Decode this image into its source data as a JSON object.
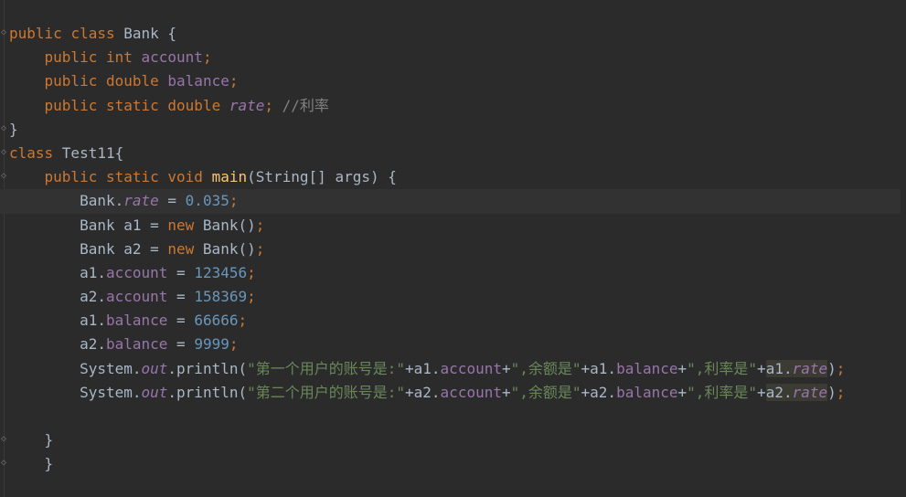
{
  "editor": {
    "theme_colors": {
      "background": "#2b2b2b",
      "keyword": "#cc7832",
      "field": "#9876aa",
      "number": "#6897bb",
      "string": "#6a8759",
      "comment": "#808080",
      "method": "#ffc66d",
      "text": "#a9b7c6"
    },
    "lines": [
      {
        "tokens": [
          [
            "kw",
            "public "
          ],
          [
            "kw",
            "class "
          ],
          [
            "plain",
            "Bank {"
          ]
        ]
      },
      {
        "tokens": [
          [
            "plain",
            "    "
          ],
          [
            "kw",
            "public "
          ],
          [
            "kw",
            "int "
          ],
          [
            "fld",
            "account"
          ],
          [
            "kw",
            ";"
          ]
        ]
      },
      {
        "tokens": [
          [
            "plain",
            "    "
          ],
          [
            "kw",
            "public "
          ],
          [
            "kw",
            "double "
          ],
          [
            "fld",
            "balance"
          ],
          [
            "kw",
            ";"
          ]
        ]
      },
      {
        "tokens": [
          [
            "plain",
            "    "
          ],
          [
            "kw",
            "public "
          ],
          [
            "kw",
            "static "
          ],
          [
            "kw",
            "double "
          ],
          [
            "sfld",
            "rate"
          ],
          [
            "kw",
            "; "
          ],
          [
            "cmt",
            "//利率"
          ]
        ]
      },
      {
        "tokens": [
          [
            "plain",
            "}"
          ]
        ]
      },
      {
        "tokens": [
          [
            "kw",
            "class "
          ],
          [
            "plain",
            "Test11{"
          ]
        ]
      },
      {
        "tokens": [
          [
            "plain",
            "    "
          ],
          [
            "kw",
            "public "
          ],
          [
            "kw",
            "static "
          ],
          [
            "kw",
            "void "
          ],
          [
            "fn",
            "main"
          ],
          [
            "plain",
            "(String[] args) {"
          ]
        ]
      },
      {
        "tokens": [
          [
            "plain",
            "        Bank."
          ],
          [
            "sfld",
            "rate"
          ],
          [
            "plain",
            " = "
          ],
          [
            "num",
            "0.035"
          ],
          [
            "kw",
            ";"
          ]
        ]
      },
      {
        "tokens": [
          [
            "plain",
            "        Bank a1 = "
          ],
          [
            "kw",
            "new "
          ],
          [
            "plain",
            "Bank()"
          ],
          [
            "kw",
            ";"
          ]
        ]
      },
      {
        "tokens": [
          [
            "plain",
            "        Bank a2 = "
          ],
          [
            "kw",
            "new "
          ],
          [
            "plain",
            "Bank()"
          ],
          [
            "kw",
            ";"
          ]
        ]
      },
      {
        "tokens": [
          [
            "plain",
            "        a1."
          ],
          [
            "fld",
            "account"
          ],
          [
            "plain",
            " = "
          ],
          [
            "num",
            "123456"
          ],
          [
            "kw",
            ";"
          ]
        ]
      },
      {
        "tokens": [
          [
            "plain",
            "        a2."
          ],
          [
            "fld",
            "account"
          ],
          [
            "plain",
            " = "
          ],
          [
            "num",
            "158369"
          ],
          [
            "kw",
            ";"
          ]
        ]
      },
      {
        "tokens": [
          [
            "plain",
            "        a1."
          ],
          [
            "fld",
            "balance"
          ],
          [
            "plain",
            " = "
          ],
          [
            "num",
            "66666"
          ],
          [
            "kw",
            ";"
          ]
        ]
      },
      {
        "tokens": [
          [
            "plain",
            "        a2."
          ],
          [
            "fld",
            "balance"
          ],
          [
            "plain",
            " = "
          ],
          [
            "num",
            "9999"
          ],
          [
            "kw",
            ";"
          ]
        ]
      },
      {
        "tokens": [
          [
            "plain",
            "        System."
          ],
          [
            "sfld",
            "out"
          ],
          [
            "plain",
            ".println("
          ],
          [
            "str",
            "\"第一个用户的账号是:\""
          ],
          [
            "plain",
            "+a1."
          ],
          [
            "fld",
            "account"
          ],
          [
            "plain",
            "+"
          ],
          [
            "str",
            "\",余额是\""
          ],
          [
            "plain",
            "+a1."
          ],
          [
            "fld",
            "balance"
          ],
          [
            "plain",
            "+"
          ],
          [
            "str",
            "\",利率是\""
          ],
          [
            "plain",
            "+"
          ],
          [
            "hlp",
            "a1."
          ],
          [
            "hls",
            "rate"
          ],
          [
            "plain",
            ")"
          ],
          [
            "kw",
            ";"
          ]
        ]
      },
      {
        "tokens": [
          [
            "plain",
            "        System."
          ],
          [
            "sfld",
            "out"
          ],
          [
            "plain",
            ".println("
          ],
          [
            "str",
            "\"第二个用户的账号是:\""
          ],
          [
            "plain",
            "+a2."
          ],
          [
            "fld",
            "account"
          ],
          [
            "plain",
            "+"
          ],
          [
            "str",
            "\",余额是\""
          ],
          [
            "plain",
            "+a2."
          ],
          [
            "fld",
            "balance"
          ],
          [
            "plain",
            "+"
          ],
          [
            "str",
            "\",利率是\""
          ],
          [
            "plain",
            "+"
          ],
          [
            "hlp",
            "a2."
          ],
          [
            "hls",
            "rate"
          ],
          [
            "plain",
            ")"
          ],
          [
            "kw",
            ";"
          ]
        ]
      },
      {
        "tokens": [
          [
            "plain",
            ""
          ]
        ]
      },
      {
        "tokens": [
          [
            "plain",
            "    }"
          ]
        ]
      },
      {
        "tokens": [
          [
            "plain",
            "    }"
          ]
        ]
      }
    ]
  }
}
